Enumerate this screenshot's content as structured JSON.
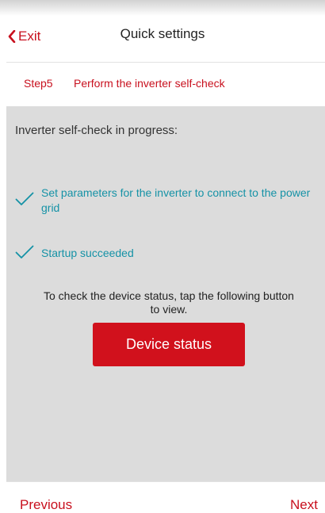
{
  "header": {
    "exit_label": "Exit",
    "title": "Quick settings"
  },
  "step": {
    "number": "Step5",
    "text": "Perform the inverter self-check"
  },
  "main": {
    "heading": "Inverter self-check in progress:",
    "checks": [
      {
        "text": "Set parameters for the inverter to connect to the power grid",
        "icon": "checkmark-icon"
      },
      {
        "text": "Startup succeeded",
        "icon": "checkmark-icon"
      }
    ],
    "hint": "To check the device status, tap the following button to view.",
    "device_button_label": "Device status"
  },
  "footer": {
    "previous_label": "Previous",
    "next_label": "Next"
  },
  "colors": {
    "accent": "#c8101e",
    "button": "#d1111c",
    "check": "#1592a6",
    "panel": "#dcdcdc"
  }
}
